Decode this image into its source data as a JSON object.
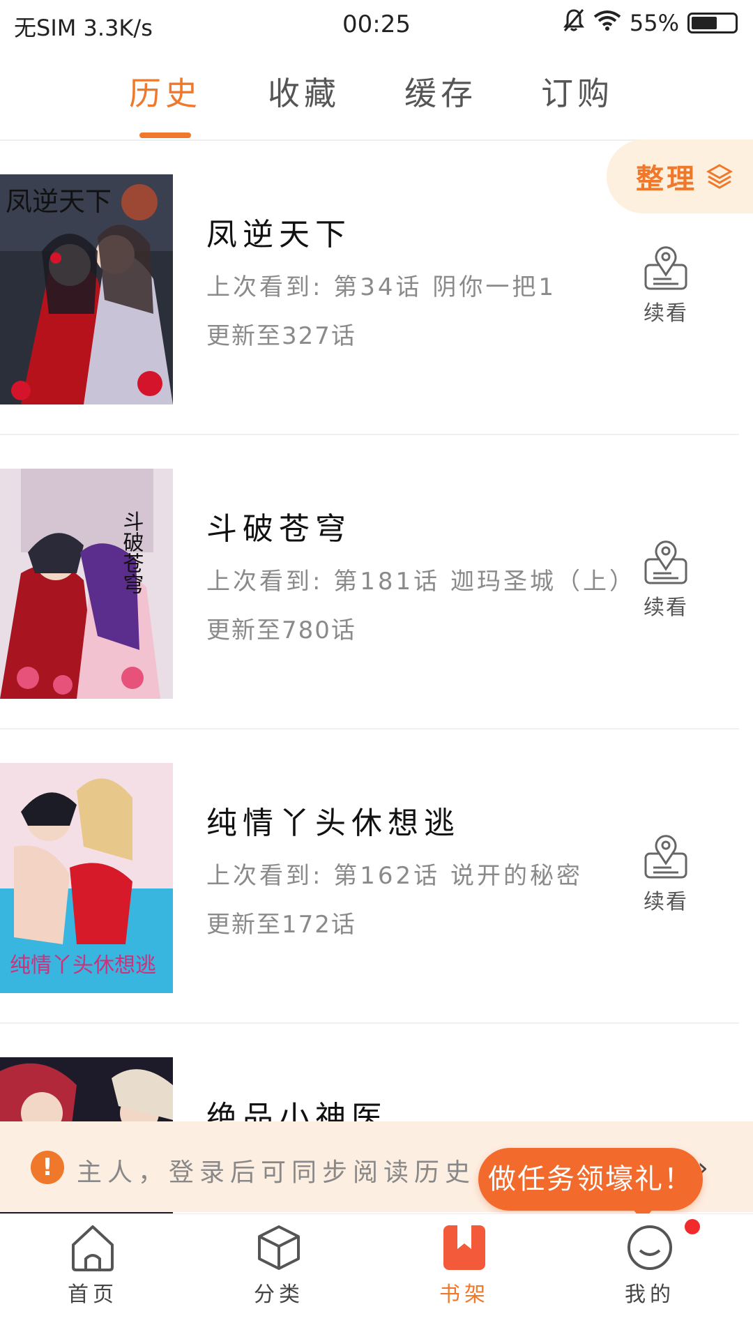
{
  "status_bar": {
    "carrier": "无SIM 3.3K/s",
    "time": "00:25",
    "battery": "55%",
    "battery_level": 0.55
  },
  "tabs": [
    {
      "label": "历史",
      "active": true
    },
    {
      "label": "收藏",
      "active": false
    },
    {
      "label": "缓存",
      "active": false
    },
    {
      "label": "订购",
      "active": false
    }
  ],
  "organize_label": "整理",
  "comics": [
    {
      "title": "凤逆天下",
      "last_read": "上次看到: 第34话 阴你一把1",
      "update": "更新至327话",
      "continue_label": "续看",
      "cover_text": "凤逆天下"
    },
    {
      "title": "斗破苍穹",
      "last_read": "上次看到: 第181话 迦玛圣城（上）",
      "update": "更新至780话",
      "continue_label": "续看",
      "cover_text": "斗破苍穹"
    },
    {
      "title": "纯情丫头休想逃",
      "last_read": "上次看到: 第162话 说开的秘密",
      "update": "更新至172话",
      "continue_label": "续看",
      "cover_text": "纯情丫头休想逃"
    },
    {
      "title": "绝品小神医",
      "last_read": "",
      "update": "",
      "continue_label": "",
      "cover_text": ""
    }
  ],
  "login_banner": {
    "icon": "!",
    "text": "主人，登录后可同步阅读历史",
    "task_button": "做任务领壕礼！",
    "chevron": "›"
  },
  "bottom_nav": [
    {
      "label": "首页",
      "icon": "home-icon",
      "active": false
    },
    {
      "label": "分类",
      "icon": "cube-icon",
      "active": false
    },
    {
      "label": "书架",
      "icon": "bookshelf-icon",
      "active": true
    },
    {
      "label": "我的",
      "icon": "profile-icon",
      "active": false
    }
  ],
  "colors": {
    "accent": "#f0782a",
    "banner_bg": "#fdeee2",
    "organize_bg": "#fdf0de",
    "notification_dot": "#f12b2b"
  }
}
